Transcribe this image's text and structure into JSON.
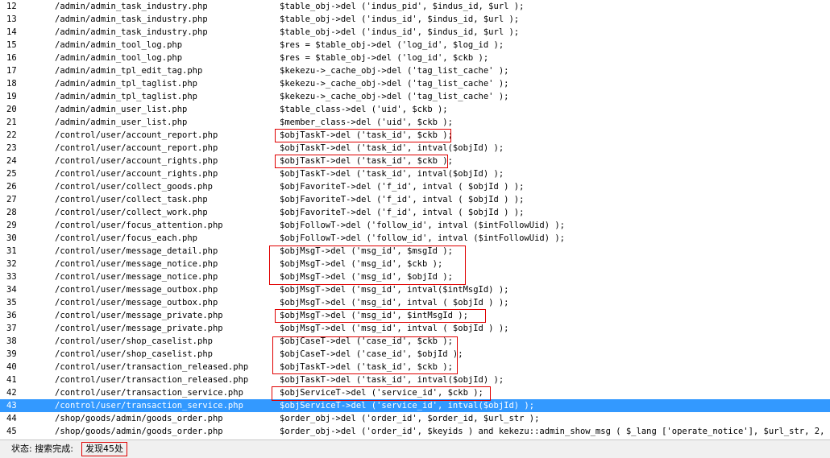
{
  "results": [
    {
      "num": "12",
      "file": "/admin/admin_task_industry.php",
      "code": "$table_obj->del ('indus_pid', $indus_id, $url );"
    },
    {
      "num": "13",
      "file": "/admin/admin_task_industry.php",
      "code": "$table_obj->del ('indus_id', $indus_id, $url );"
    },
    {
      "num": "14",
      "file": "/admin/admin_task_industry.php",
      "code": "$table_obj->del ('indus_id', $indus_id, $url );"
    },
    {
      "num": "15",
      "file": "/admin/admin_tool_log.php",
      "code": "$res = $table_obj->del ('log_id', $log_id );"
    },
    {
      "num": "16",
      "file": "/admin/admin_tool_log.php",
      "code": "$res = $table_obj->del ('log_id', $ckb );"
    },
    {
      "num": "17",
      "file": "/admin/admin_tpl_edit_tag.php",
      "code": "$kekezu->_cache_obj->del ('tag_list_cache' );"
    },
    {
      "num": "18",
      "file": "/admin/admin_tpl_taglist.php",
      "code": "$kekezu->_cache_obj->del ('tag_list_cache' );"
    },
    {
      "num": "19",
      "file": "/admin/admin_tpl_taglist.php",
      "code": "$kekezu->_cache_obj->del ('tag_list_cache' );"
    },
    {
      "num": "20",
      "file": "/admin/admin_user_list.php",
      "code": "$table_class->del ('uid', $ckb );"
    },
    {
      "num": "21",
      "file": "/admin/admin_user_list.php",
      "code": "$member_class->del ('uid', $ckb );"
    },
    {
      "num": "22",
      "file": "/control/user/account_report.php",
      "code": "$objTaskT->del ('task_id', $ckb );"
    },
    {
      "num": "23",
      "file": "/control/user/account_report.php",
      "code": "$objTaskT->del ('task_id', intval($objId) );"
    },
    {
      "num": "24",
      "file": "/control/user/account_rights.php",
      "code": "$objTaskT->del ('task_id', $ckb );"
    },
    {
      "num": "25",
      "file": "/control/user/account_rights.php",
      "code": "$objTaskT->del ('task_id', intval($objId) );"
    },
    {
      "num": "26",
      "file": "/control/user/collect_goods.php",
      "code": "$objFavoriteT->del ('f_id', intval ( $objId ) );"
    },
    {
      "num": "27",
      "file": "/control/user/collect_task.php",
      "code": "$objFavoriteT->del ('f_id', intval ( $objId ) );"
    },
    {
      "num": "28",
      "file": "/control/user/collect_work.php",
      "code": "$objFavoriteT->del ('f_id', intval ( $objId ) );"
    },
    {
      "num": "29",
      "file": "/control/user/focus_attention.php",
      "code": "$objFollowT->del ('follow_id', intval ($intFollowUid) );"
    },
    {
      "num": "30",
      "file": "/control/user/focus_each.php",
      "code": "$objFollowT->del ('follow_id', intval ($intFollowUid) );"
    },
    {
      "num": "31",
      "file": "/control/user/message_detail.php",
      "code": "$objMsgT->del ('msg_id', $msgId );"
    },
    {
      "num": "32",
      "file": "/control/user/message_notice.php",
      "code": "$objMsgT->del ('msg_id', $ckb );"
    },
    {
      "num": "33",
      "file": "/control/user/message_notice.php",
      "code": "$objMsgT->del ('msg_id', $objId );"
    },
    {
      "num": "34",
      "file": "/control/user/message_outbox.php",
      "code": "$objMsgT->del ('msg_id', intval($intMsgId) );"
    },
    {
      "num": "35",
      "file": "/control/user/message_outbox.php",
      "code": "$objMsgT->del ('msg_id', intval ( $objId ) );"
    },
    {
      "num": "36",
      "file": "/control/user/message_private.php",
      "code": "$objMsgT->del ('msg_id', $intMsgId );"
    },
    {
      "num": "37",
      "file": "/control/user/message_private.php",
      "code": "$objMsgT->del ('msg_id', intval ( $objId ) );"
    },
    {
      "num": "38",
      "file": "/control/user/shop_caselist.php",
      "code": "$objCaseT->del ('case_id', $ckb );"
    },
    {
      "num": "39",
      "file": "/control/user/shop_caselist.php",
      "code": "$objCaseT->del ('case_id', $objId );"
    },
    {
      "num": "40",
      "file": "/control/user/transaction_released.php",
      "code": "$objTaskT->del ('task_id', $ckb );"
    },
    {
      "num": "41",
      "file": "/control/user/transaction_released.php",
      "code": "$objTaskT->del ('task_id', intval($objId) );"
    },
    {
      "num": "42",
      "file": "/control/user/transaction_service.php",
      "code": "$objServiceT->del ('service_id', $ckb );"
    },
    {
      "num": "43",
      "file": "/control/user/transaction_service.php",
      "code": "$objServiceT->del ('service_id', intval($objId) );"
    },
    {
      "num": "44",
      "file": "/shop/goods/admin/goods_order.php",
      "code": "$order_obj->del ('order_id', $order_id, $url_str );"
    },
    {
      "num": "45",
      "file": "/shop/goods/admin/goods_order.php",
      "code": "$order_obj->del ('order_id', $keyids ) and kekezu::admin_show_msg ( $_lang ['operate_notice'], $url_str, 2, $_la..."
    }
  ],
  "selected_row": "43",
  "status": {
    "label": "状态: 搜索完成:",
    "value": "发现45处"
  },
  "colors": {
    "selection": "#3399ff",
    "highlight_box": "#e00000"
  }
}
